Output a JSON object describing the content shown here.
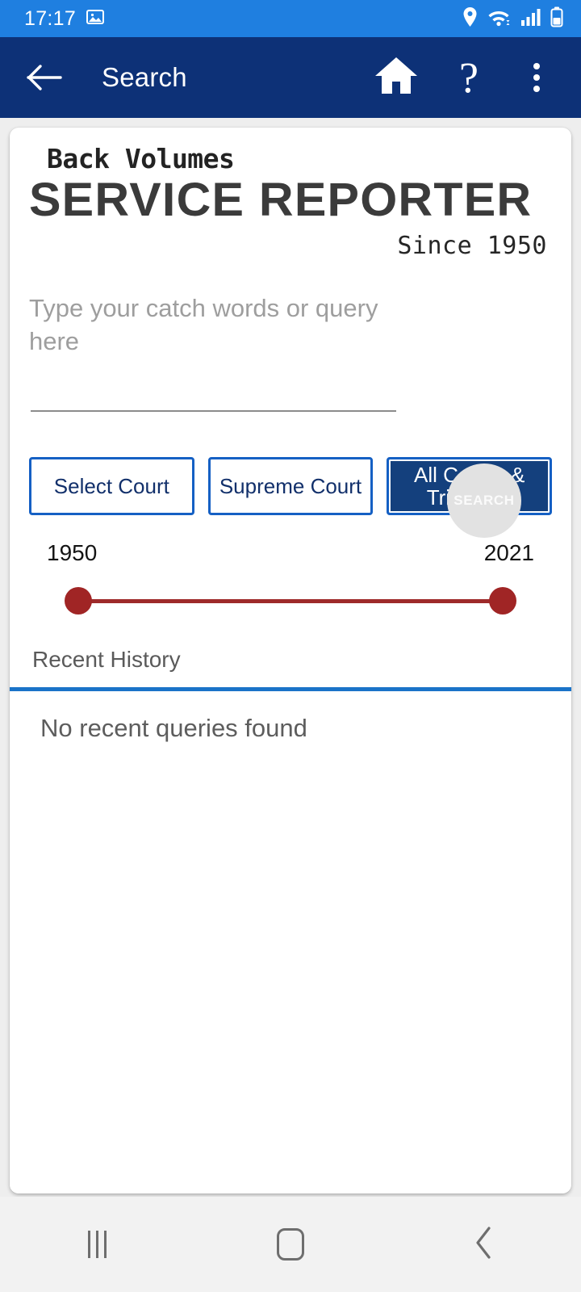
{
  "status_bar": {
    "time": "17:17",
    "icons": [
      "image-icon",
      "location-pin-icon",
      "wifi-icon",
      "signal-bars-icon",
      "battery-icon"
    ]
  },
  "app_bar": {
    "back_label": "back-arrow",
    "title": "Search",
    "actions": [
      {
        "name": "home-icon",
        "label": "Home"
      },
      {
        "name": "help-icon",
        "label": "?"
      },
      {
        "name": "overflow-menu-icon",
        "label": "More options"
      }
    ]
  },
  "masthead": {
    "line1": "Back Volumes",
    "line2": "SERVICE REPORTER",
    "line3": "Since 1950"
  },
  "search": {
    "value": "",
    "placeholder": "Type your catch words or query here",
    "button_label": "SEARCH"
  },
  "court_filters": [
    {
      "label": "Select Court",
      "active": false
    },
    {
      "label": "Supreme Court",
      "active": false
    },
    {
      "label": "All Courts & Tribunals",
      "active": true
    }
  ],
  "year_range": {
    "min_label": "1950",
    "max_label": "2021",
    "min": 1950,
    "max": 2021,
    "selected_low": 1950,
    "selected_high": 2021
  },
  "history": {
    "tab_label": "Recent History",
    "empty_message": "No recent queries found"
  },
  "nav_bar": {
    "recents_label": "recents-icon",
    "home_label": "home-icon",
    "back_label": "back-icon"
  },
  "colors": {
    "status_bar": "#1f7fe0",
    "app_bar": "#0d3177",
    "accent_blue": "#1560c4",
    "active_navy": "#14407d",
    "tab_indicator": "#1a73c8",
    "slider_red": "#a02525",
    "search_circle": "#e2e2e2"
  }
}
